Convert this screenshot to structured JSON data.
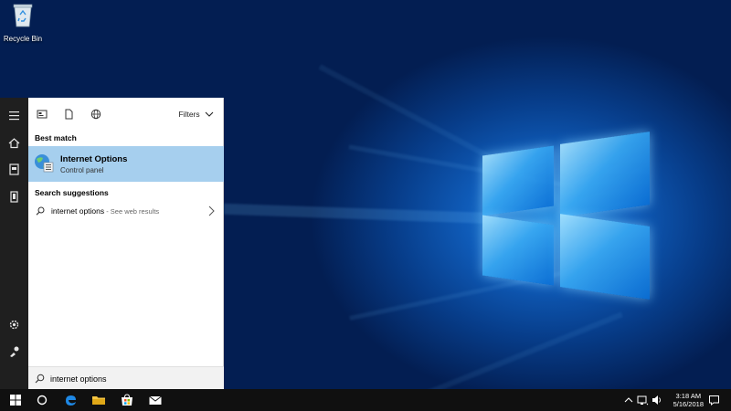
{
  "desktop": {
    "recycle_bin_label": "Recycle Bin"
  },
  "rail": {
    "icons": [
      "hamburger-icon",
      "home-icon",
      "notebook-icon",
      "device-icon",
      "settings-icon",
      "feedback-icon"
    ]
  },
  "search_panel": {
    "filters_label": "Filters",
    "best_match_label": "Best match",
    "best_match": {
      "title": "Internet Options",
      "subtitle": "Control panel"
    },
    "suggestions_label": "Search suggestions",
    "suggestion": {
      "query": "internet options",
      "hint": " - See web results"
    },
    "search_value": "internet options"
  },
  "taskbar": {
    "time": "3:18 AM",
    "date": "5/16/2018"
  },
  "colors": {
    "selection": "#a6cfee",
    "taskbar": "#101010",
    "rail": "#1f1f1f"
  }
}
